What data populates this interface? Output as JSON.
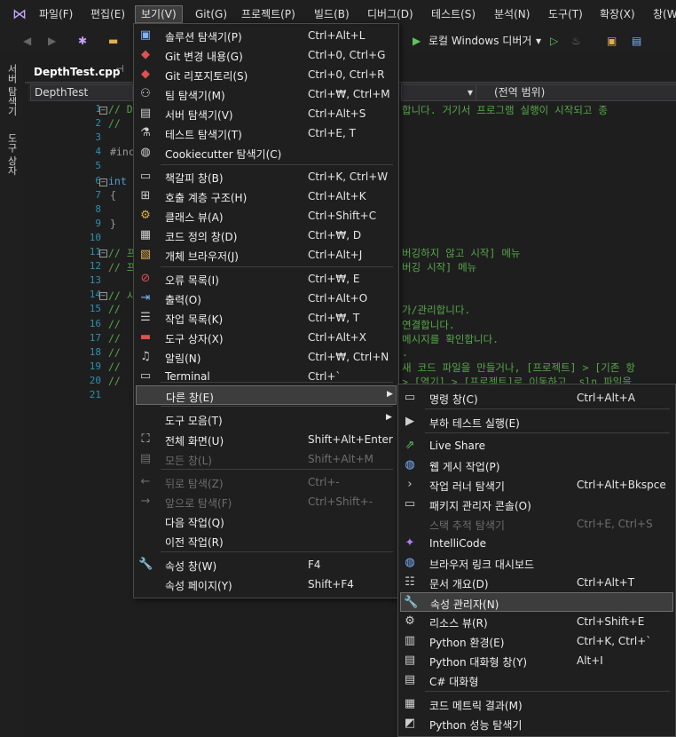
{
  "menubar": {
    "items": [
      "파일(F)",
      "편집(E)",
      "보기(V)",
      "Git(G)",
      "프로젝트(P)",
      "빌드(B)",
      "디버그(D)",
      "테스트(S)",
      "분석(N)",
      "도구(T)",
      "확장(X)",
      "창(W)"
    ]
  },
  "toolbar": {
    "run_target": "로컬 Windows 디버거",
    "run_dropdown": "▾"
  },
  "left_strip": {
    "server_explorer": "서버 탐색기",
    "toolbox": "도구 상자"
  },
  "doc_tab": {
    "file": "DepthTest.cpp",
    "pin": "⊣"
  },
  "navbar": {
    "project": "DepthTest",
    "scope": "(전역 범위)"
  },
  "editor": {
    "line_numbers": [
      "1",
      "2",
      "3",
      "4",
      "5",
      "6",
      "7",
      "8",
      "9",
      "10",
      "11",
      "12",
      "13",
      "14",
      "15",
      "16",
      "17",
      "18",
      "19",
      "20",
      "21"
    ],
    "lines": [
      "// D",
      "//",
      "",
      "#inc",
      "",
      "int",
      "{",
      "",
      "}",
      "",
      "// 프",
      "// 프",
      "",
      "// 시",
      "//",
      "//",
      "//",
      "//",
      "//",
      "//",
      ""
    ],
    "right_fragments": [
      {
        "line": 1,
        "text": "합니다. 거기서 프로그램 실행이 시작되고 종"
      },
      {
        "line": 11,
        "text": "버깅하지 않고 시작] 메뉴"
      },
      {
        "line": 12,
        "text": "버깅 시작] 메뉴"
      },
      {
        "line": 15,
        "text": "가/관리합니다."
      },
      {
        "line": 16,
        "text": "연결합니다."
      },
      {
        "line": 17,
        "text": "메시지를 확인합니다."
      },
      {
        "line": 18,
        "text": "."
      },
      {
        "line": 19,
        "text": "새 코드 파일을 만들거나, [프로젝트] > [기존 항"
      },
      {
        "line": 20,
        "text": "> [열기] > [프로젝트]로 이동하고 .sln 파일을"
      }
    ]
  },
  "view_menu": {
    "items": [
      {
        "label": "솔루션 탐색기(P)",
        "shortcut": "Ctrl+Alt+L",
        "icon": "solution-explorer-icon",
        "glyph": "▣",
        "color": "#7fb3ff",
        "disabled": false
      },
      {
        "label": "Git 변경 내용(G)",
        "shortcut": "Ctrl+0, Ctrl+G",
        "icon": "git-changes-icon",
        "glyph": "◆",
        "color": "#e05050",
        "disabled": false
      },
      {
        "label": "Git 리포지토리(S)",
        "shortcut": "Ctrl+0, Ctrl+R",
        "icon": "git-repository-icon",
        "glyph": "◆",
        "color": "#e05050",
        "disabled": false
      },
      {
        "label": "팀 탐색기(M)",
        "shortcut": "Ctrl+₩, Ctrl+M",
        "icon": "team-explorer-icon",
        "glyph": "⚇",
        "color": "#cfcfcf",
        "disabled": false
      },
      {
        "label": "서버 탐색기(V)",
        "shortcut": "Ctrl+Alt+S",
        "icon": "server-explorer-icon",
        "glyph": "▤",
        "color": "#cfcfcf",
        "disabled": false
      },
      {
        "label": "테스트 탐색기(T)",
        "shortcut": "Ctrl+E, T",
        "icon": "test-explorer-icon",
        "glyph": "⚗",
        "color": "#cfcfcf",
        "disabled": false
      },
      {
        "label": "Cookiecutter 탐색기(C)",
        "shortcut": "",
        "icon": "cookiecutter-icon",
        "glyph": "◍",
        "color": "#cfcfcf",
        "disabled": false
      },
      {
        "label": "책갈피 창(B)",
        "shortcut": "Ctrl+K, Ctrl+W",
        "icon": "bookmark-icon",
        "glyph": "▭",
        "color": "#cfcfcf",
        "disabled": false
      },
      {
        "label": "호출 계층 구조(H)",
        "shortcut": "Ctrl+Alt+K",
        "icon": "call-hierarchy-icon",
        "glyph": "⊞",
        "color": "#cfcfcf",
        "disabled": false
      },
      {
        "label": "클래스 뷰(A)",
        "shortcut": "Ctrl+Shift+C",
        "icon": "class-view-icon",
        "glyph": "⚙",
        "color": "#e0b050",
        "disabled": false
      },
      {
        "label": "코드 정의 창(D)",
        "shortcut": "Ctrl+₩, D",
        "icon": "code-definition-icon",
        "glyph": "▦",
        "color": "#cfcfcf",
        "disabled": false
      },
      {
        "label": "개체 브라우저(J)",
        "shortcut": "Ctrl+Alt+J",
        "icon": "object-browser-icon",
        "glyph": "▧",
        "color": "#e0b050",
        "disabled": false
      },
      {
        "label": "오류 목록(I)",
        "shortcut": "Ctrl+₩, E",
        "icon": "error-list-icon",
        "glyph": "⊘",
        "color": "#e05050",
        "disabled": false
      },
      {
        "label": "출력(O)",
        "shortcut": "Ctrl+Alt+O",
        "icon": "output-icon",
        "glyph": "⇥",
        "color": "#7fb3ff",
        "disabled": false
      },
      {
        "label": "작업 목록(K)",
        "shortcut": "Ctrl+₩, T",
        "icon": "task-list-icon",
        "glyph": "☰",
        "color": "#cfcfcf",
        "disabled": false
      },
      {
        "label": "도구 상자(X)",
        "shortcut": "Ctrl+Alt+X",
        "icon": "toolbox-icon",
        "glyph": "▬",
        "color": "#e05050",
        "disabled": false
      },
      {
        "label": "알림(N)",
        "shortcut": "Ctrl+₩, Ctrl+N",
        "icon": "notification-bell-icon",
        "glyph": "♫",
        "color": "#cfcfcf",
        "disabled": false
      },
      {
        "label": "Terminal",
        "shortcut": "Ctrl+`",
        "icon": "terminal-icon",
        "glyph": "▭",
        "color": "#cfcfcf",
        "disabled": false
      },
      {
        "label": "다른 창(E)",
        "shortcut": "",
        "icon": "",
        "glyph": "",
        "color": "#cfcfcf",
        "disabled": false,
        "submenu": true,
        "highlighted": true
      },
      {
        "label": "도구 모음(T)",
        "shortcut": "",
        "icon": "",
        "glyph": "",
        "color": "#cfcfcf",
        "disabled": false,
        "submenu": true
      },
      {
        "label": "전체 화면(U)",
        "shortcut": "Shift+Alt+Enter",
        "icon": "full-screen-icon",
        "glyph": "⛶",
        "color": "#cfcfcf",
        "disabled": false
      },
      {
        "label": "모든 창(L)",
        "shortcut": "Shift+Alt+M",
        "icon": "all-windows-icon",
        "glyph": "▤",
        "color": "#6d6d6d",
        "disabled": true
      },
      {
        "label": "뒤로 탐색(Z)",
        "shortcut": "Ctrl+-",
        "icon": "navigate-back-icon",
        "glyph": "←",
        "color": "#6d6d6d",
        "disabled": true
      },
      {
        "label": "앞으로 탐색(F)",
        "shortcut": "Ctrl+Shift+-",
        "icon": "navigate-forward-icon",
        "glyph": "→",
        "color": "#6d6d6d",
        "disabled": true
      },
      {
        "label": "다음 작업(Q)",
        "shortcut": "",
        "icon": "",
        "glyph": "",
        "color": "#cfcfcf",
        "disabled": false
      },
      {
        "label": "이전 작업(R)",
        "shortcut": "",
        "icon": "",
        "glyph": "",
        "color": "#cfcfcf",
        "disabled": false
      },
      {
        "label": "속성 창(W)",
        "shortcut": "F4",
        "icon": "wrench-icon",
        "glyph": "🔧",
        "color": "#cfcfcf",
        "disabled": false
      },
      {
        "label": "속성 페이지(Y)",
        "shortcut": "Shift+F4",
        "icon": "",
        "glyph": "",
        "color": "#cfcfcf",
        "disabled": false
      }
    ]
  },
  "other_windows_menu": {
    "items": [
      {
        "label": "명령 창(C)",
        "shortcut": "Ctrl+Alt+A",
        "icon": "command-window-icon",
        "glyph": "▭",
        "color": "#cfcfcf",
        "disabled": false
      },
      {
        "label": "부하 테스트 실행(E)",
        "shortcut": "",
        "icon": "load-test-icon",
        "glyph": "▶",
        "color": "#cfcfcf",
        "disabled": false
      },
      {
        "label": "Live Share",
        "shortcut": "",
        "icon": "live-share-icon",
        "glyph": "⇗",
        "color": "#5ec45e",
        "disabled": false
      },
      {
        "label": "웹 게시 작업(P)",
        "shortcut": "",
        "icon": "web-publish-icon",
        "glyph": "◍",
        "color": "#7fb3ff",
        "disabled": false
      },
      {
        "label": "작업 러너 탐색기",
        "shortcut": "Ctrl+Alt+Bkspce",
        "icon": "task-runner-icon",
        "glyph": "›",
        "color": "#cfcfcf",
        "disabled": false
      },
      {
        "label": "패키지 관리자 콘솔(O)",
        "shortcut": "",
        "icon": "package-console-icon",
        "glyph": "▭",
        "color": "#cfcfcf",
        "disabled": false
      },
      {
        "label": "스택 추적 탐색기",
        "shortcut": "Ctrl+E, Ctrl+S",
        "icon": "",
        "glyph": "",
        "color": "#6d6d6d",
        "disabled": true
      },
      {
        "label": "IntelliCode",
        "shortcut": "",
        "icon": "intellicode-icon",
        "glyph": "✦",
        "color": "#b07fff",
        "disabled": false
      },
      {
        "label": "브라우저 링크 대시보드",
        "shortcut": "",
        "icon": "browser-link-icon",
        "glyph": "◍",
        "color": "#7fb3ff",
        "disabled": false
      },
      {
        "label": "문서 개요(D)",
        "shortcut": "Ctrl+Alt+T",
        "icon": "document-outline-icon",
        "glyph": "☷",
        "color": "#cfcfcf",
        "disabled": false
      },
      {
        "label": "속성 관리자(N)",
        "shortcut": "",
        "icon": "property-manager-wrench-icon",
        "glyph": "🔧",
        "color": "#cfcfcf",
        "disabled": false,
        "highlighted": true
      },
      {
        "label": "리소스 뷰(R)",
        "shortcut": "Ctrl+Shift+E",
        "icon": "resource-view-icon",
        "glyph": "⚙",
        "color": "#cfcfcf",
        "disabled": false
      },
      {
        "label": "Python 환경(E)",
        "shortcut": "Ctrl+K, Ctrl+`",
        "icon": "python-env-icon",
        "glyph": "▥",
        "color": "#cfcfcf",
        "disabled": false
      },
      {
        "label": "Python 대화형 창(Y)",
        "shortcut": "Alt+I",
        "icon": "python-interactive-icon",
        "glyph": "▤",
        "color": "#cfcfcf",
        "disabled": false
      },
      {
        "label": "C# 대화형",
        "shortcut": "",
        "icon": "csharp-interactive-icon",
        "glyph": "▤",
        "color": "#cfcfcf",
        "disabled": false
      },
      {
        "label": "코드 메트릭 결과(M)",
        "shortcut": "",
        "icon": "code-metrics-icon",
        "glyph": "▦",
        "color": "#cfcfcf",
        "disabled": false
      },
      {
        "label": "Python 성능 탐색기",
        "shortcut": "",
        "icon": "python-profiler-icon",
        "glyph": "◩",
        "color": "#cfcfcf",
        "disabled": false
      }
    ]
  }
}
